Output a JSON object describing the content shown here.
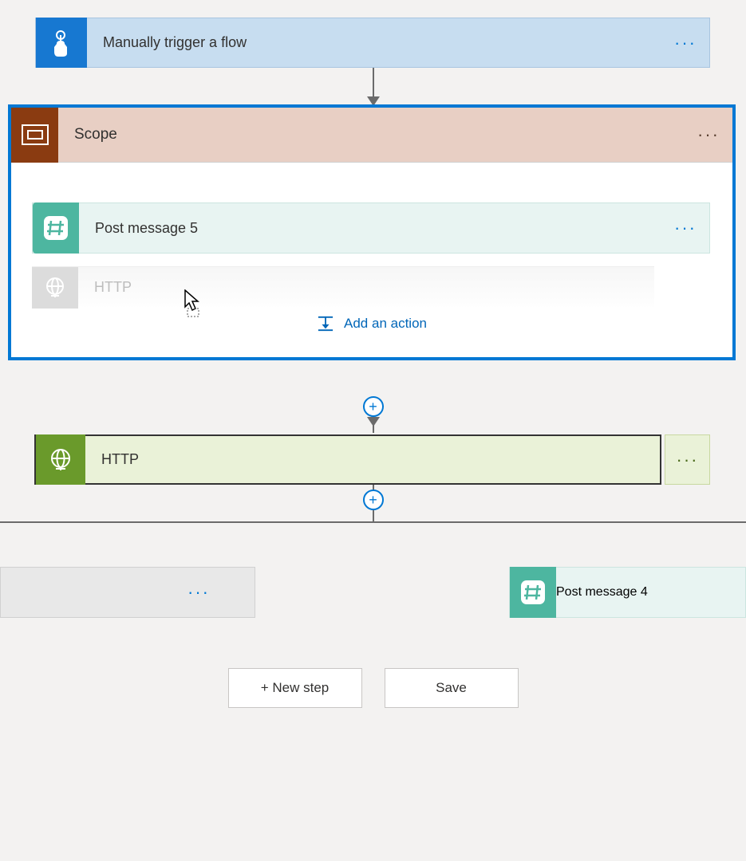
{
  "trigger": {
    "label": "Manually trigger a flow"
  },
  "scope": {
    "label": "Scope",
    "actions": {
      "post_message_5": {
        "label": "Post message 5"
      },
      "http_ghost": {
        "label": "HTTP"
      }
    },
    "add_action_label": "Add an action"
  },
  "http_card": {
    "label": "HTTP"
  },
  "branches": {
    "right": {
      "label": "Post message 4"
    }
  },
  "buttons": {
    "new_step": "+ New step",
    "save": "Save"
  }
}
